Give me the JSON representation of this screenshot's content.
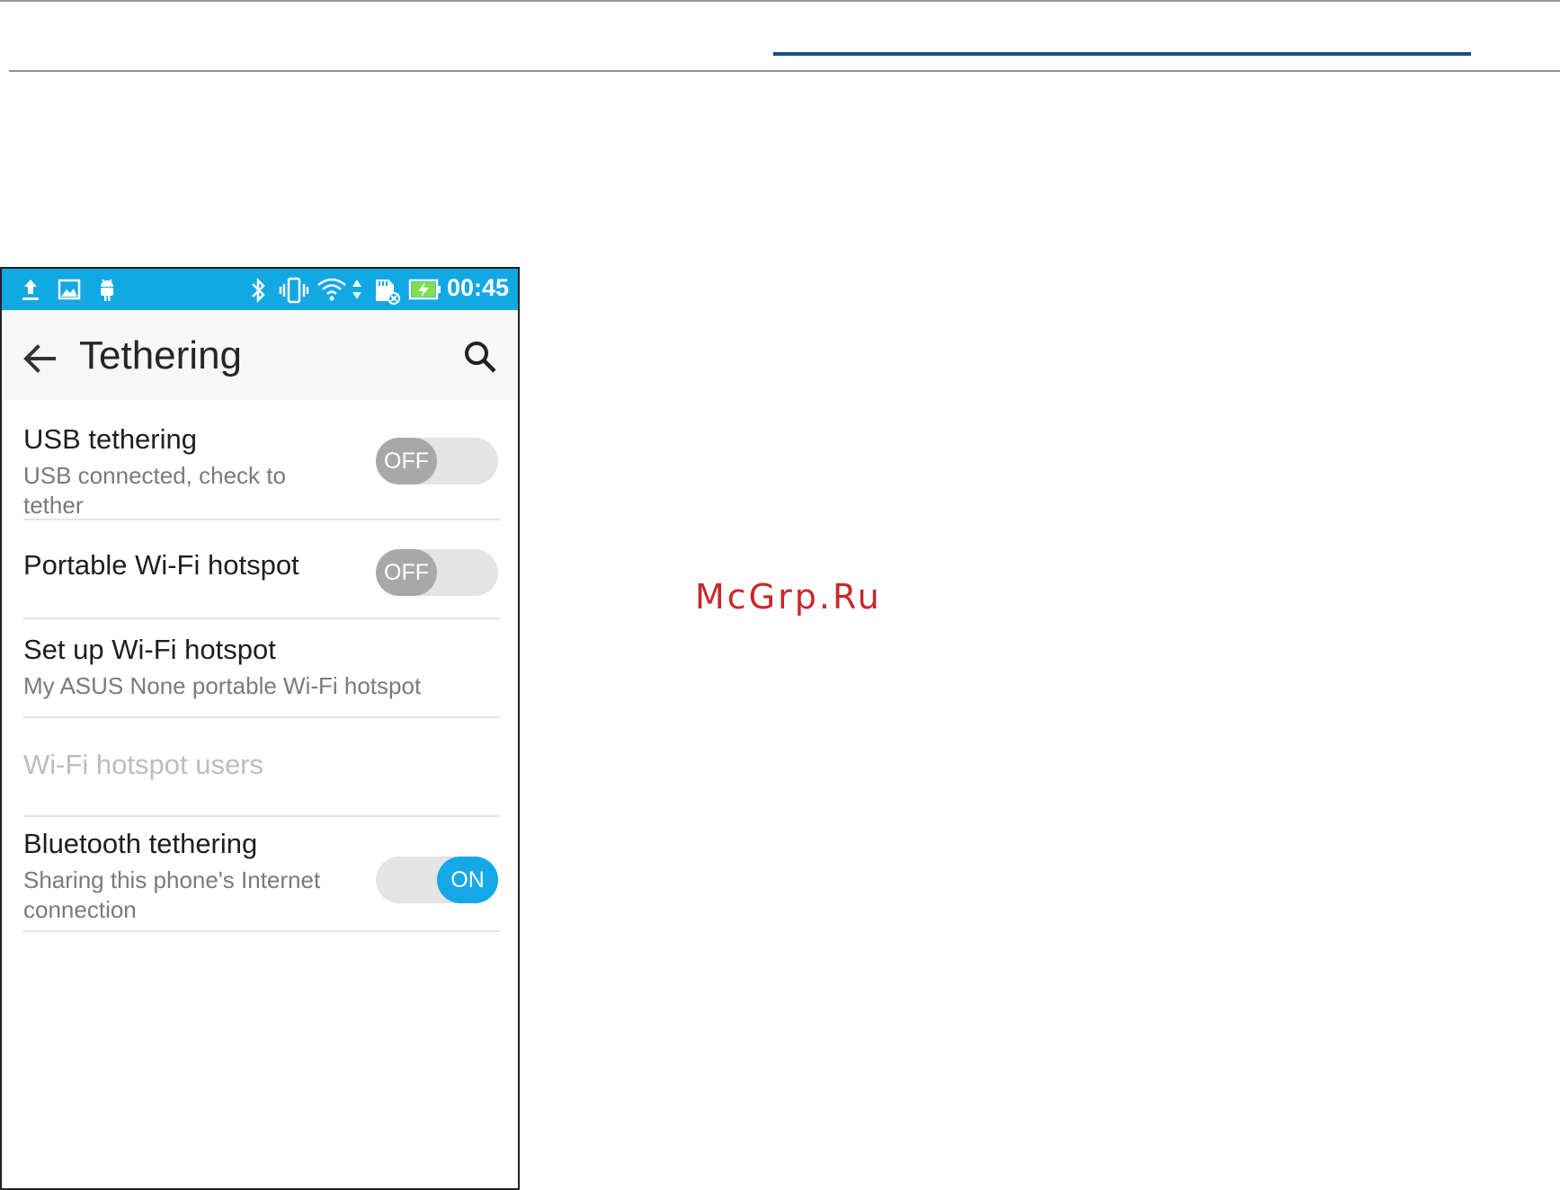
{
  "watermark": "McGrp.Ru",
  "status_bar": {
    "time": "00:45",
    "icons": [
      "upload-icon",
      "image-icon",
      "android-debug-icon",
      "bluetooth-icon",
      "vibrate-icon",
      "wifi-icon",
      "data-arrows-icon",
      "sd-card-icon",
      "battery-charging-icon"
    ]
  },
  "app_bar": {
    "title": "Tethering",
    "back_icon": "arrow-left-icon",
    "search_icon": "search-icon"
  },
  "settings": {
    "usb": {
      "title": "USB tethering",
      "subtitle": "USB connected, check to tether",
      "toggle_label": "OFF",
      "enabled": false
    },
    "hotspot": {
      "title": "Portable Wi-Fi hotspot",
      "toggle_label": "OFF",
      "enabled": false
    },
    "setup_hotspot": {
      "title": "Set up Wi-Fi hotspot",
      "subtitle": "My ASUS None portable Wi-Fi hotspot"
    },
    "hotspot_users": {
      "title": "Wi-Fi hotspot users",
      "disabled": true
    },
    "bluetooth": {
      "title": "Bluetooth tethering",
      "subtitle": "Sharing this phone's Internet connection",
      "toggle_label": "ON",
      "enabled": true
    }
  },
  "colors": {
    "status_bar": "#12a8e3",
    "toggle_on": "#14a9e6",
    "toggle_off_knob": "#a8a8a8",
    "watermark": "#c8282c",
    "doc_header_underline": "#1c4a8c"
  }
}
